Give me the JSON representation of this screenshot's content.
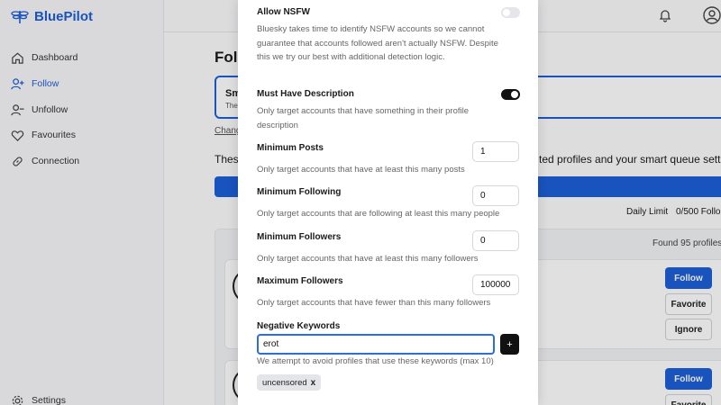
{
  "app": {
    "name": "BluePilot"
  },
  "sidebar": {
    "items": [
      {
        "label": "Dashboard",
        "icon": "home-icon"
      },
      {
        "label": "Follow",
        "icon": "user-plus-icon",
        "active": true
      },
      {
        "label": "Unfollow",
        "icon": "user-minus-icon"
      },
      {
        "label": "Favourites",
        "icon": "heart-icon"
      },
      {
        "label": "Connection",
        "icon": "link-icon"
      }
    ],
    "settings_label": "Settings"
  },
  "main": {
    "title_partial": "Foll",
    "mode_card_title_partial": "Sm",
    "mode_card_sub_partial": "The",
    "change_link_partial": "Chang",
    "desc_left_partial": "These",
    "desc_right_partial": "ted profiles and your smart queue setting",
    "daily_limit_label": "Daily Limit",
    "daily_limit_value": "0/500 Follo",
    "found_text": "Found 95 profiles",
    "actions": {
      "follow": "Follow",
      "favorite": "Favorite",
      "ignore": "Ignore"
    }
  },
  "modal": {
    "allow_nsfw": {
      "label": "Allow NSFW",
      "help": "Bluesky takes time to identify NSFW accounts so we cannot guarantee that accounts followed aren't actually NSFW. Despite this we try our best with additional detection logic.",
      "enabled": false
    },
    "must_have_description": {
      "label": "Must Have Description",
      "help": "Only target accounts that have something in their profile description",
      "enabled": true
    },
    "minimum_posts": {
      "label": "Minimum Posts",
      "value": "1",
      "help": "Only target accounts that have at least this many posts"
    },
    "minimum_following": {
      "label": "Minimum Following",
      "value": "0",
      "help": "Only target accounts that are following at least this many people"
    },
    "minimum_followers": {
      "label": "Minimum Followers",
      "value": "0",
      "help": "Only target accounts that have at least this many followers"
    },
    "maximum_followers": {
      "label": "Maximum Followers",
      "value": "100000",
      "help": "Only target accounts that have fewer than this many followers"
    },
    "negative_keywords": {
      "label": "Negative Keywords",
      "input_value": "erot",
      "add_label": "+",
      "help": "We attempt to avoid profiles that use these keywords (max 10)",
      "chips": [
        {
          "label": "uncensored",
          "remove": "x"
        }
      ]
    }
  },
  "colors": {
    "accent": "#1d5fd8",
    "toggle_on": "#111111",
    "toggle_off": "#e4e6e9"
  }
}
